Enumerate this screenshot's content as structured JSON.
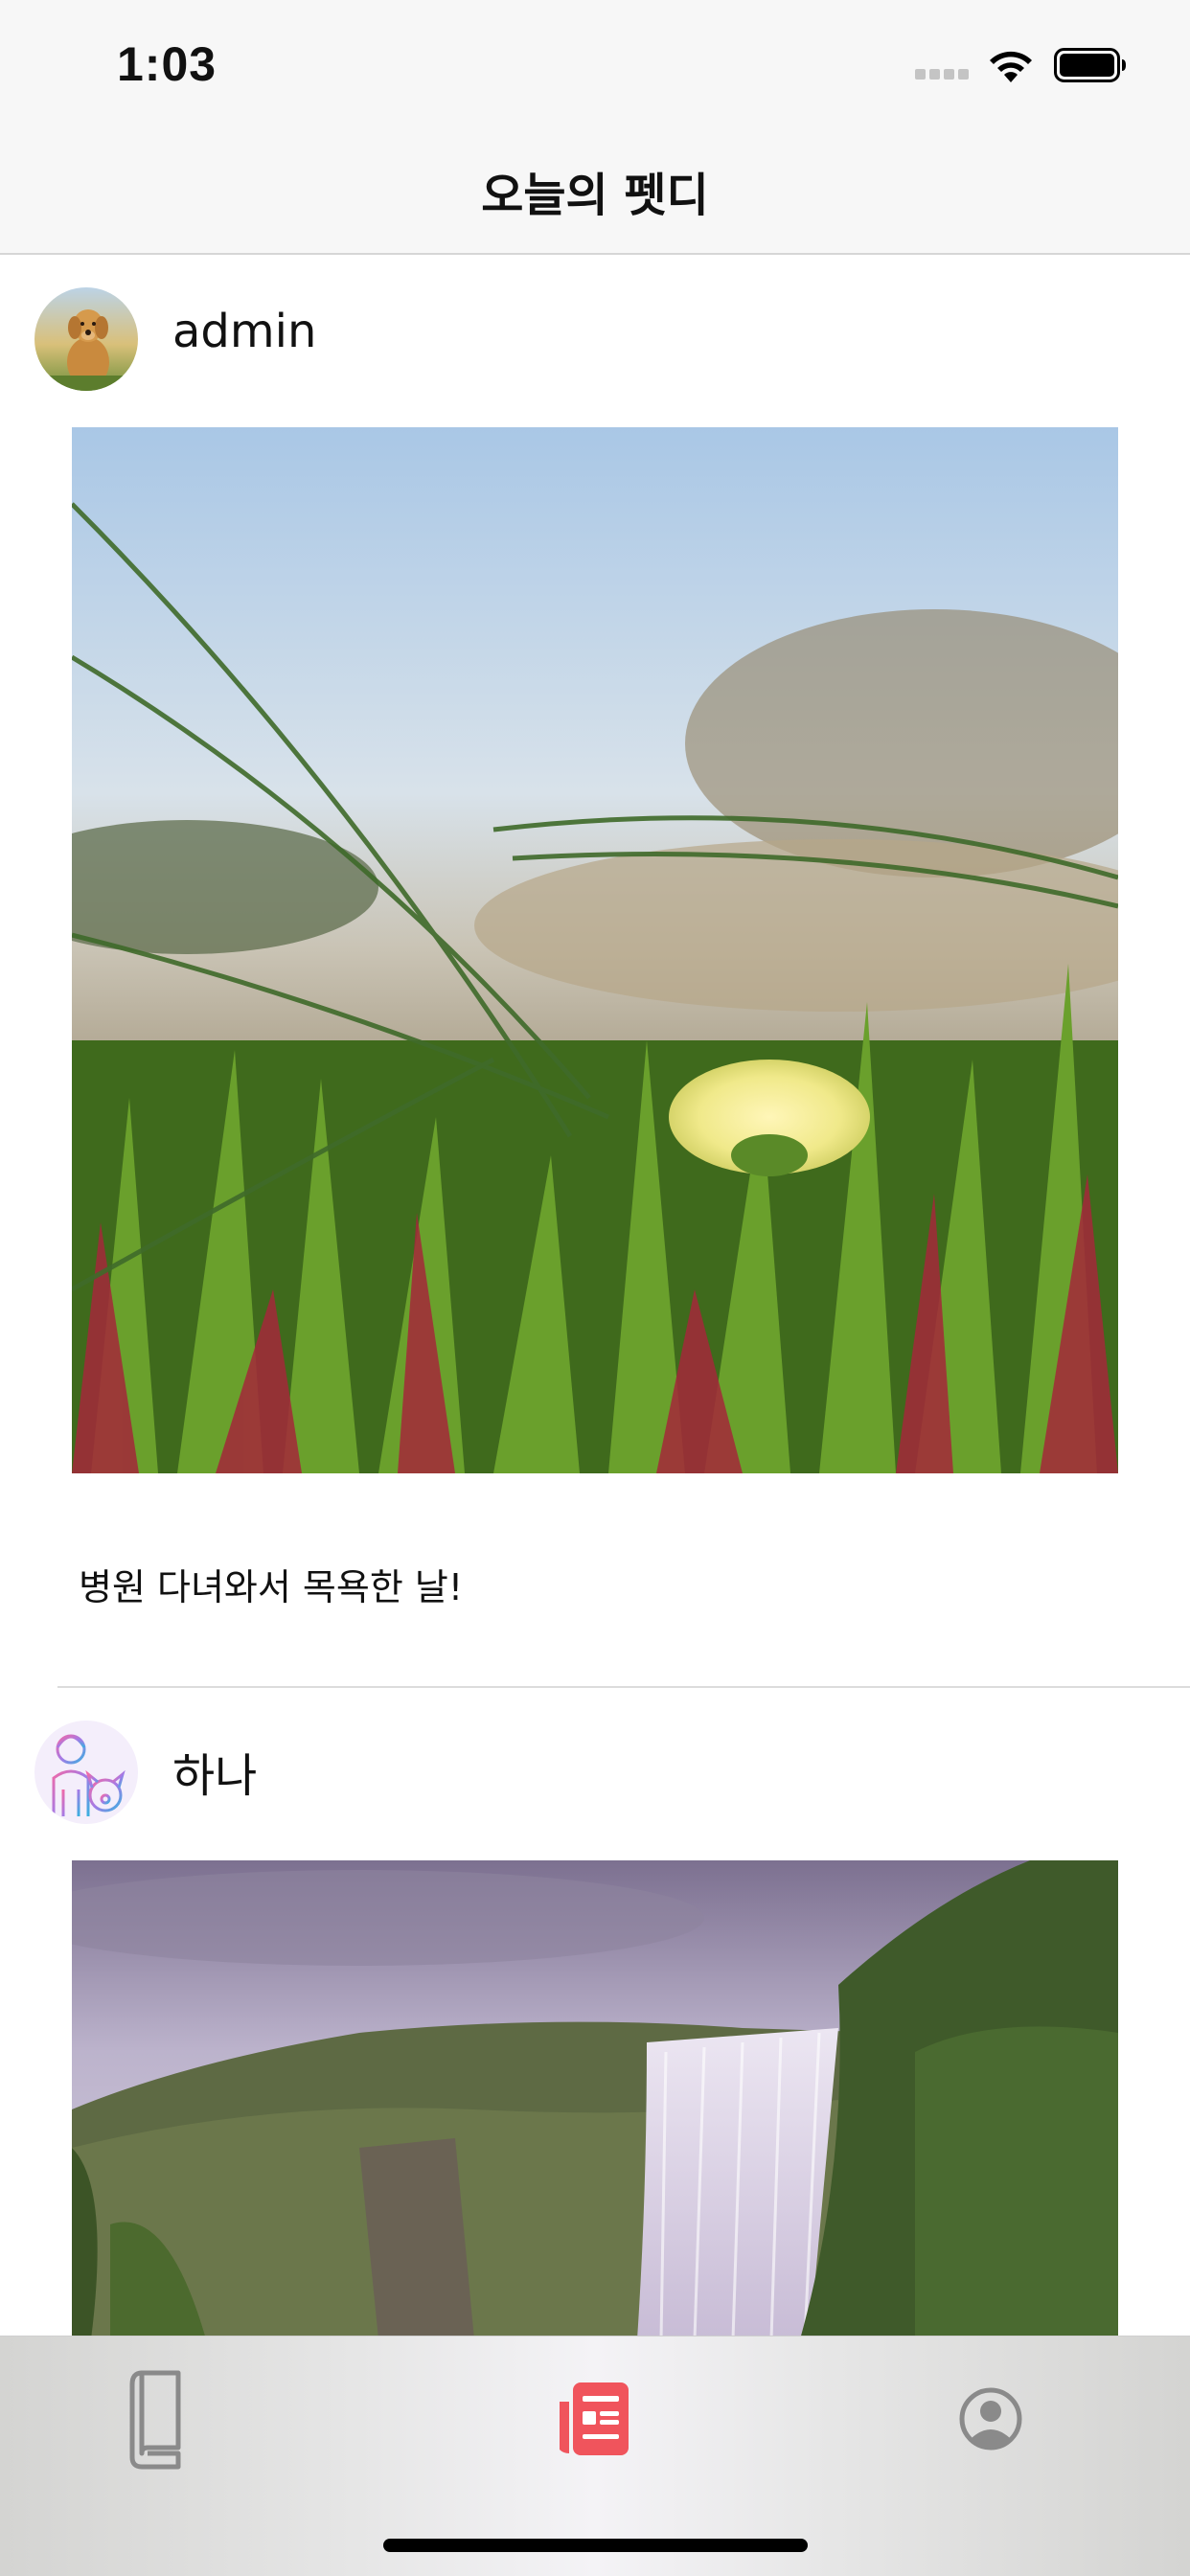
{
  "status_bar": {
    "time": "1:03"
  },
  "nav": {
    "title": "오늘의 펫디"
  },
  "posts": [
    {
      "username": "admin",
      "caption": "병원 다녀와서 목욕한 날!"
    },
    {
      "username": "하나",
      "caption": ""
    }
  ],
  "tabs": [
    {
      "icon": "book-icon",
      "active": false
    },
    {
      "icon": "newspaper-icon",
      "active": true
    },
    {
      "icon": "profile-icon",
      "active": false
    }
  ],
  "colors": {
    "accent": "#f0545c",
    "inactive": "#8a8a8a"
  }
}
